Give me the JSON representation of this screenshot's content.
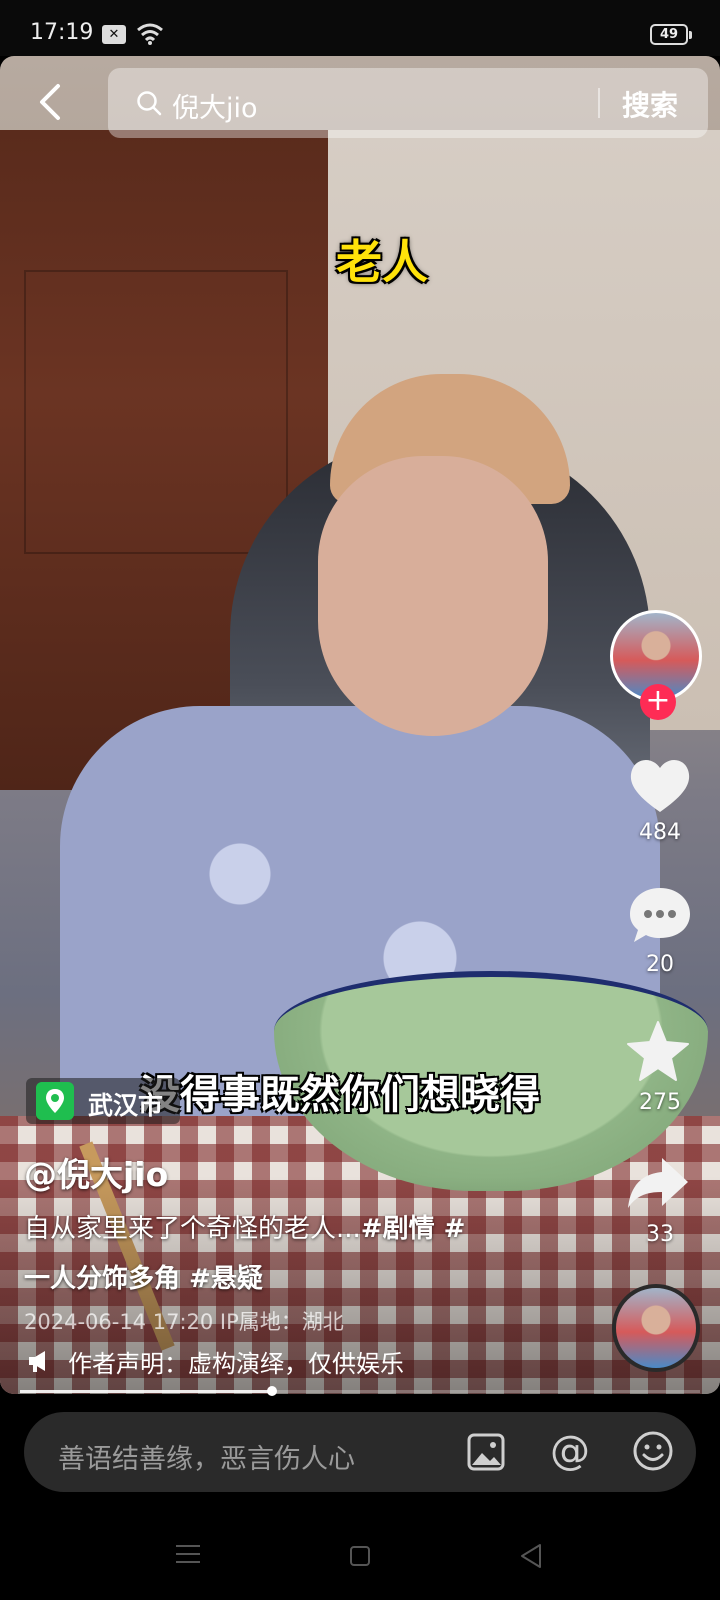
{
  "status_bar": {
    "time": "17:19",
    "battery": "49",
    "icons": [
      "notification-icon",
      "wifi-icon",
      "battery-icon"
    ]
  },
  "search": {
    "query": "倪大jio",
    "button_label": "搜索"
  },
  "captions": {
    "top": "老人",
    "subtitle": "没得事既然你们想晓得"
  },
  "actions": {
    "like_count": "484",
    "comment_count": "20",
    "favorite_count": "275",
    "share_count": "33",
    "follow_symbol": "+"
  },
  "info": {
    "location": "武汉市",
    "author": "@倪大jio",
    "desc_text": "自从家里来了个奇怪的老人...",
    "desc_tag1": "#剧情 #",
    "desc_line2": "一人分饰多角 #悬疑",
    "meta": "2024-06-14 17:20  IP属地：湖北",
    "disclaimer": "作者声明：虚构演绎，仅供娱乐"
  },
  "playback": {
    "progress": 0.37
  },
  "comment_input": {
    "placeholder": "善语结善缘，恶言伤人心",
    "at_symbol": "@"
  },
  "colors": {
    "accent": "#fe2c55",
    "caption_yellow": "#ffe20a",
    "location_green": "#1fbe4f"
  }
}
